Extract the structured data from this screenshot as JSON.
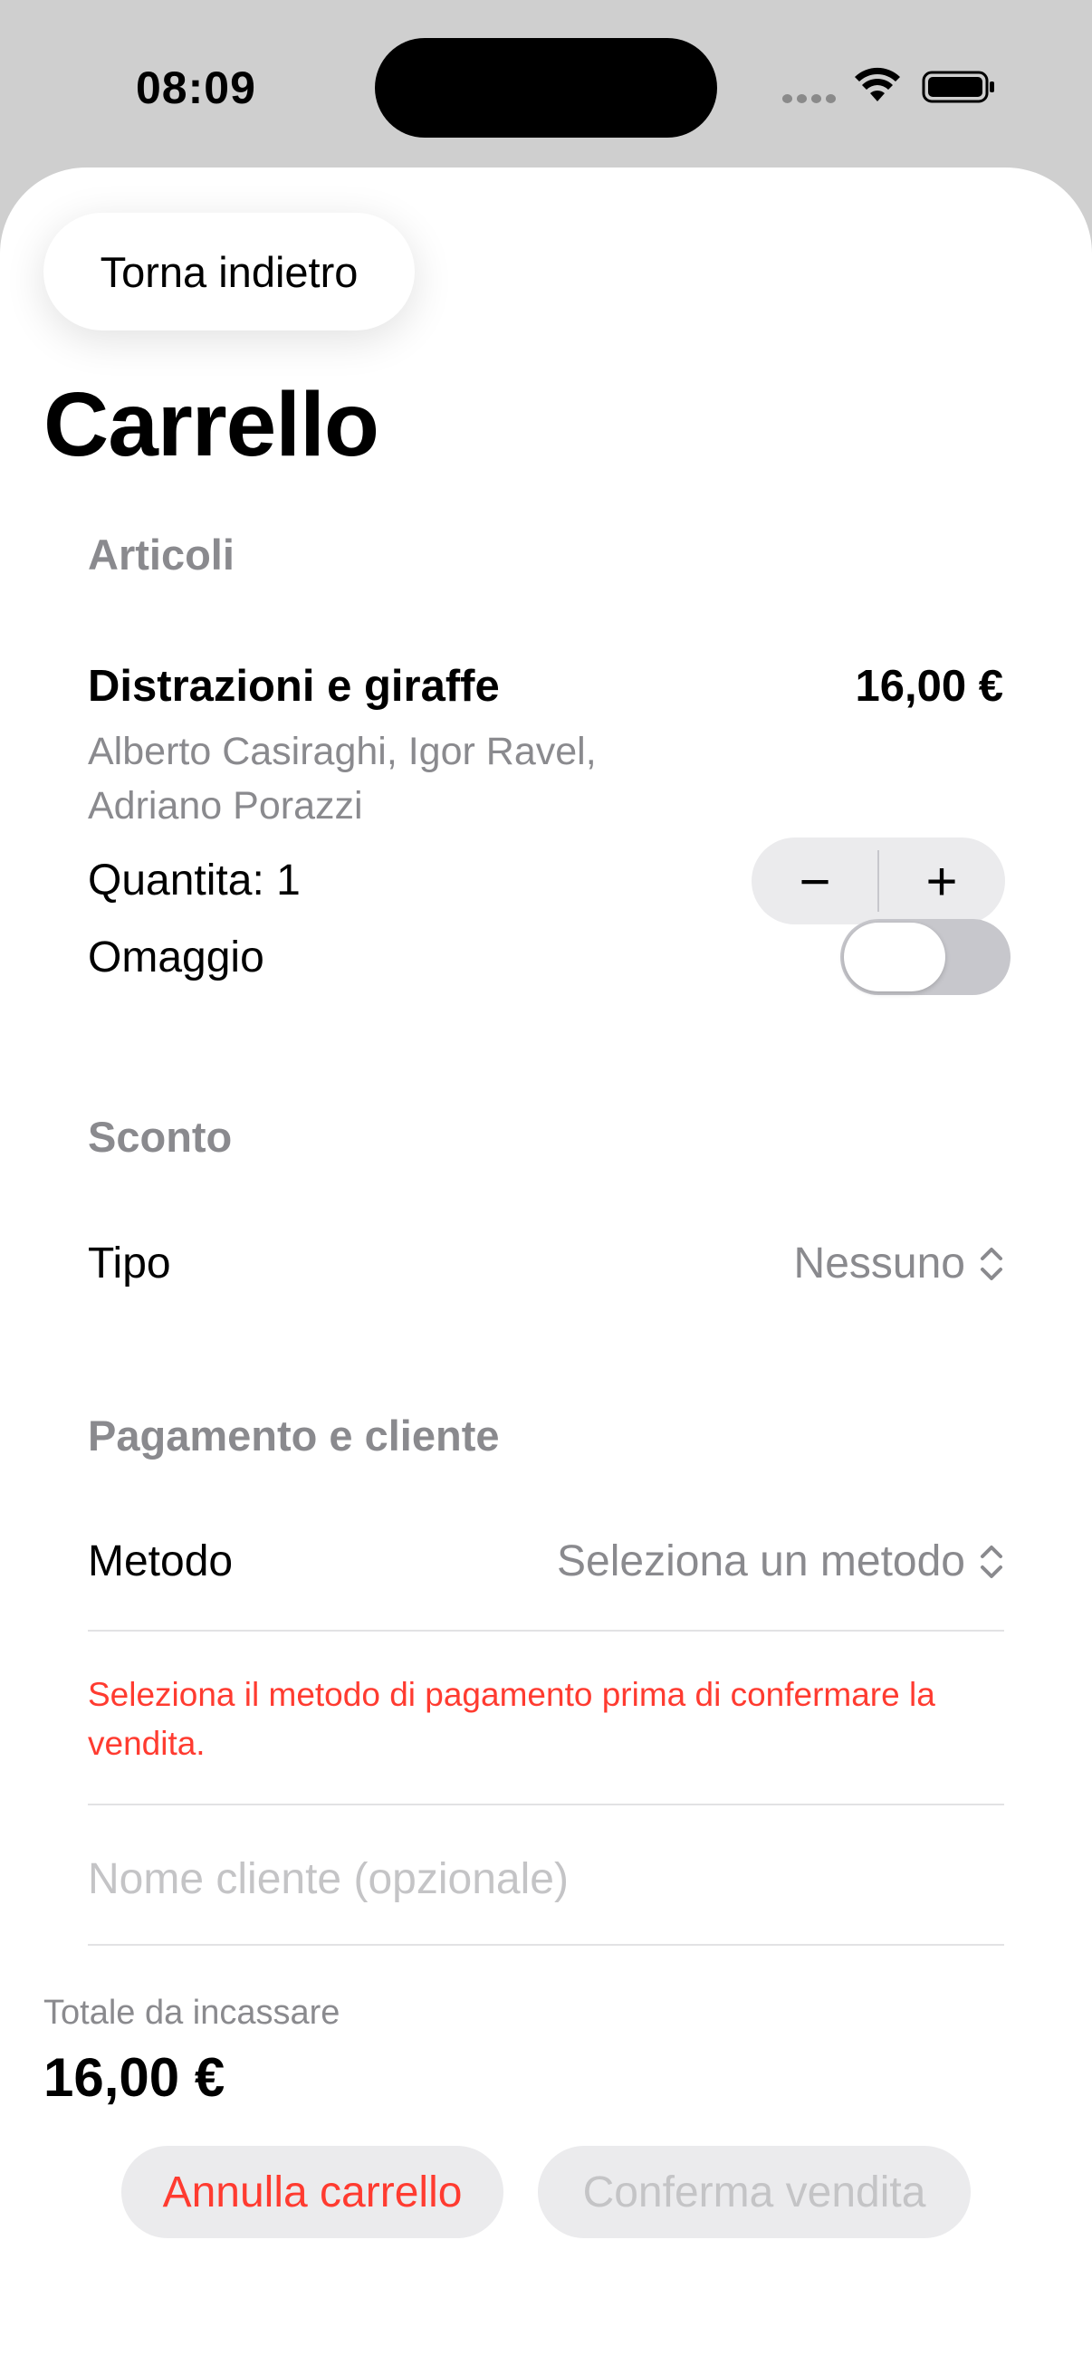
{
  "status_bar": {
    "time": "08:09",
    "icons": [
      "cellular-dots-icon",
      "wifi-icon",
      "battery-icon"
    ]
  },
  "nav": {
    "back_label": "Torna indietro"
  },
  "page": {
    "title": "Carrello"
  },
  "articles": {
    "header": "Articoli",
    "items": [
      {
        "title": "Distrazioni e giraffe",
        "price": "16,00 €",
        "authors": "Alberto Casiraghi, Igor Ravel, Adriano Porazzi",
        "quantity_label": "Quantita: 1",
        "quantity": 1,
        "gift_label": "Omaggio",
        "gift_on": false
      }
    ],
    "stepper": {
      "minus": "−",
      "plus": "+"
    }
  },
  "discount": {
    "header": "Sconto",
    "type_label": "Tipo",
    "type_value": "Nessuno"
  },
  "payment": {
    "header": "Pagamento e cliente",
    "method_label": "Metodo",
    "method_value": "Seleziona un metodo",
    "error": "Seleziona il metodo di pagamento prima di confermare la vendita.",
    "customer_placeholder": "Nome cliente (opzionale)",
    "customer_value": ""
  },
  "summary": {
    "total_label": "Totale da incassare",
    "total_value": "16,00 €"
  },
  "actions": {
    "cancel_label": "Annulla carrello",
    "confirm_label": "Conferma vendita",
    "confirm_enabled": false
  },
  "colors": {
    "accent_destructive": "#ff3b30",
    "secondary_text": "#8a8a8e",
    "placeholder": "#c4c4c6",
    "control_fill": "#ebebed"
  }
}
